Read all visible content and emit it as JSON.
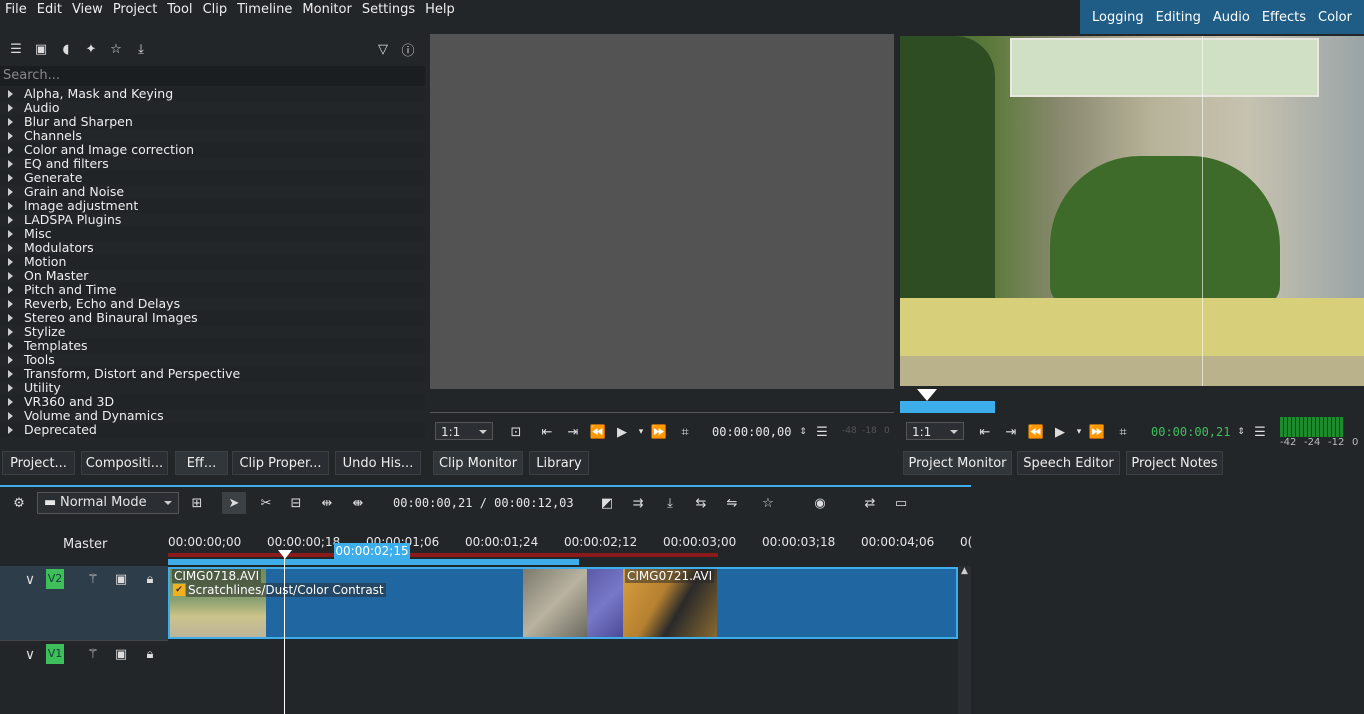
{
  "menu": [
    "File",
    "Edit",
    "View",
    "Project",
    "Tool",
    "Clip",
    "Timeline",
    "Monitor",
    "Settings",
    "Help"
  ],
  "layouts": [
    "Logging",
    "Editing",
    "Audio",
    "Effects",
    "Color"
  ],
  "effects": {
    "search_placeholder": "Search...",
    "categories": [
      "Alpha, Mask and Keying",
      "Audio",
      "Blur and Sharpen",
      "Channels",
      "Color and Image correction",
      "EQ and filters",
      "Generate",
      "Grain and Noise",
      "Image adjustment",
      "LADSPA Plugins",
      "Misc",
      "Modulators",
      "Motion",
      "On Master",
      "Pitch and Time",
      "Reverb, Echo and Delays",
      "Stereo and Binaural Images",
      "Stylize",
      "Templates",
      "Tools",
      "Transform, Distort and Perspective",
      "Utility",
      "VR360 and 3D",
      "Volume and Dynamics",
      "Deprecated"
    ]
  },
  "dock_tabs": [
    "Project...",
    "Compositi...",
    "Eff...",
    "Clip Proper...",
    "Undo His..."
  ],
  "clip_monitor": {
    "zoom": "1:1",
    "timecode": "00:00:00,00",
    "meter_labels": [
      "-48",
      "-18",
      "0"
    ],
    "tabs": [
      "Clip Monitor",
      "Library"
    ]
  },
  "project_monitor": {
    "zoom": "1:1",
    "timecode": "00:00:00,21",
    "meter_labels": [
      "-42",
      "-24",
      "-12",
      "0"
    ],
    "tabs": [
      "Project Monitor",
      "Speech Editor",
      "Project Notes"
    ]
  },
  "timeline": {
    "mode": "Normal Mode",
    "position": "00:00:00,21 / 00:00:12,03",
    "master_label": "Master",
    "ruler_ticks": [
      "00:00:00;00",
      "00:00:00;18",
      "00:00:01;06",
      "00:00:01;24",
      "00:00:02;12",
      "00:00:03;00",
      "00:00:03;18",
      "00:00:04;06",
      "0("
    ],
    "zone_label": "00:00:02;15",
    "tracks": [
      {
        "name": "V2"
      },
      {
        "name": "V1"
      }
    ],
    "clips": {
      "clip1_name": "CIMG0718.AVI",
      "clip1_effect": "Scratchlines/Dust/Color Contrast",
      "clip2_name": "CIMG0721.AVI"
    }
  },
  "colors": {
    "accent": "#3daee9",
    "clip": "#2067a2",
    "track_badge": "#3fbf5b",
    "layout_bar": "#1f5d86"
  }
}
